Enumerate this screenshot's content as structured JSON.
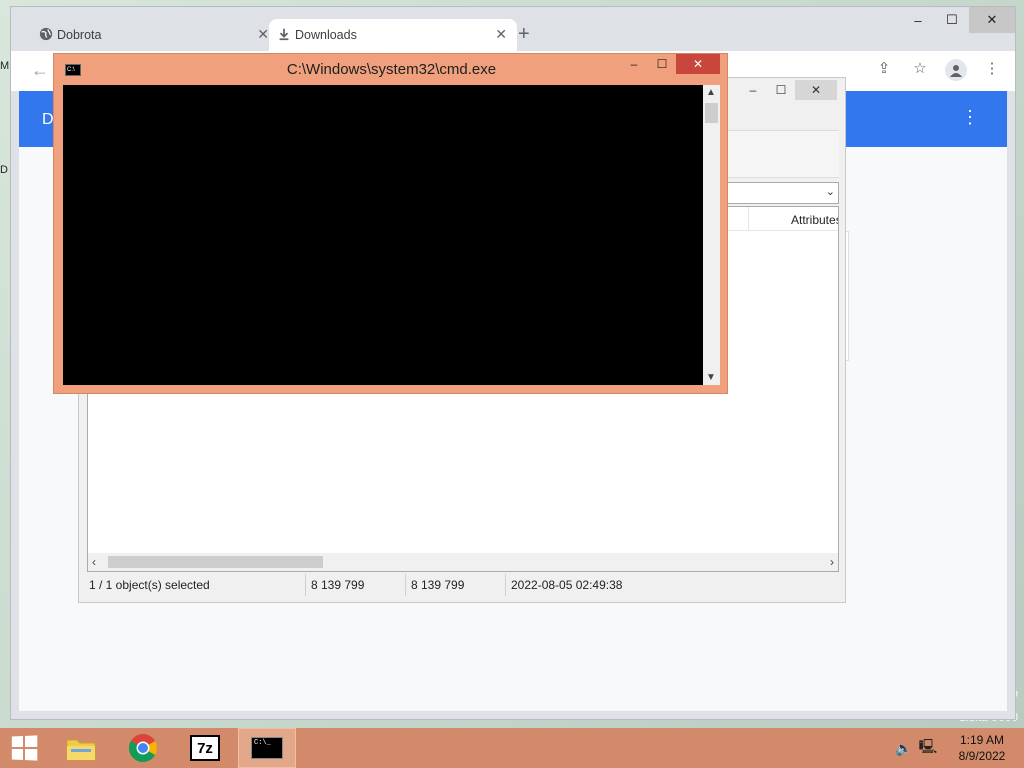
{
  "desktop": {
    "left_fragments": [
      "M",
      "D"
    ],
    "watermark_lines": [
      "o",
      "Lidita 9600"
    ]
  },
  "browser": {
    "tabs": [
      {
        "title": "Dobrota",
        "icon": "globe-icon",
        "active": false
      },
      {
        "title": "Downloads",
        "icon": "download-icon",
        "active": true
      }
    ],
    "new_tab": "+",
    "window_controls": {
      "minimize": "–",
      "maximize": "☐",
      "close": "✕"
    },
    "toolbar_icons": [
      "share-icon",
      "star-icon",
      "profile-icon",
      "menu-icon"
    ],
    "page_header": {
      "title": "D",
      "menu": "⋮"
    },
    "theme_color": "#3377ee"
  },
  "sevenzip": {
    "window_controls": {
      "minimize": "–",
      "maximize": "☐",
      "close": "✕"
    },
    "column_attributes": "Attributes",
    "status": {
      "selection": "1 / 1 object(s) selected",
      "size": "8 139 799",
      "packed_size": "8 139 799",
      "modified": "2022-08-05 02:49:38"
    }
  },
  "cmd": {
    "title": "C:\\Windows\\system32\\cmd.exe",
    "icon_label": "C:\\",
    "window_controls": {
      "minimize": "–",
      "maximize": "☐",
      "close": "✕"
    },
    "frame_color": "#f0a07c"
  },
  "taskbar": {
    "apps": [
      {
        "name": "file-explorer",
        "icon": "folder-icon"
      },
      {
        "name": "chrome",
        "icon": "chrome-icon"
      },
      {
        "name": "7-zip",
        "label": "7z",
        "icon": "sevenzip-icon"
      },
      {
        "name": "cmd",
        "label": "C:\\_",
        "icon": "cmd-icon",
        "active": true
      }
    ],
    "clock": {
      "time": "1:19 AM",
      "date": "8/9/2022"
    },
    "color": "#d28a6a"
  }
}
